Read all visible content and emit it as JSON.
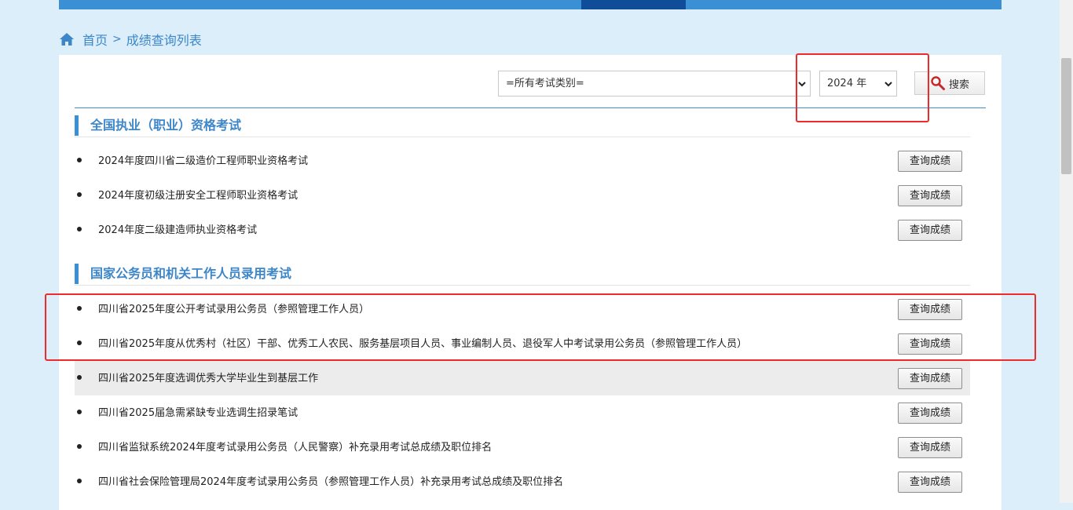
{
  "breadcrumb": {
    "home": "首页",
    "separator": ">",
    "current": "成绩查询列表"
  },
  "search": {
    "type_selected": "=所有考试类别=",
    "year_selected": "2024 年",
    "button_label": "搜索"
  },
  "sections": [
    {
      "title": "全国执业（职业）资格考试",
      "items": [
        {
          "title": "2024年度四川省二级造价工程师职业资格考试",
          "button": "查询成绩"
        },
        {
          "title": "2024年度初级注册安全工程师职业资格考试",
          "button": "查询成绩"
        },
        {
          "title": "2024年度二级建造师执业资格考试",
          "button": "查询成绩"
        }
      ]
    },
    {
      "title": "国家公务员和机关工作人员录用考试",
      "items": [
        {
          "title": "四川省2025年度公开考试录用公务员（参照管理工作人员）",
          "button": "查询成绩"
        },
        {
          "title": "四川省2025年度从优秀村（社区）干部、优秀工人农民、服务基层项目人员、事业编制人员、退役军人中考试录用公务员（参照管理工作人员）",
          "button": "查询成绩"
        },
        {
          "title": "四川省2025年度选调优秀大学毕业生到基层工作",
          "button": "查询成绩"
        },
        {
          "title": "四川省2025届急需紧缺专业选调生招录笔试",
          "button": "查询成绩"
        },
        {
          "title": "四川省监狱系统2024年度考试录用公务员（人民警察）补充录用考试总成绩及职位排名",
          "button": "查询成绩"
        },
        {
          "title": "四川省社会保险管理局2024年度考试录用公务员（参照管理工作人员）补充录用考试总成绩及职位排名",
          "button": "查询成绩"
        }
      ]
    }
  ]
}
